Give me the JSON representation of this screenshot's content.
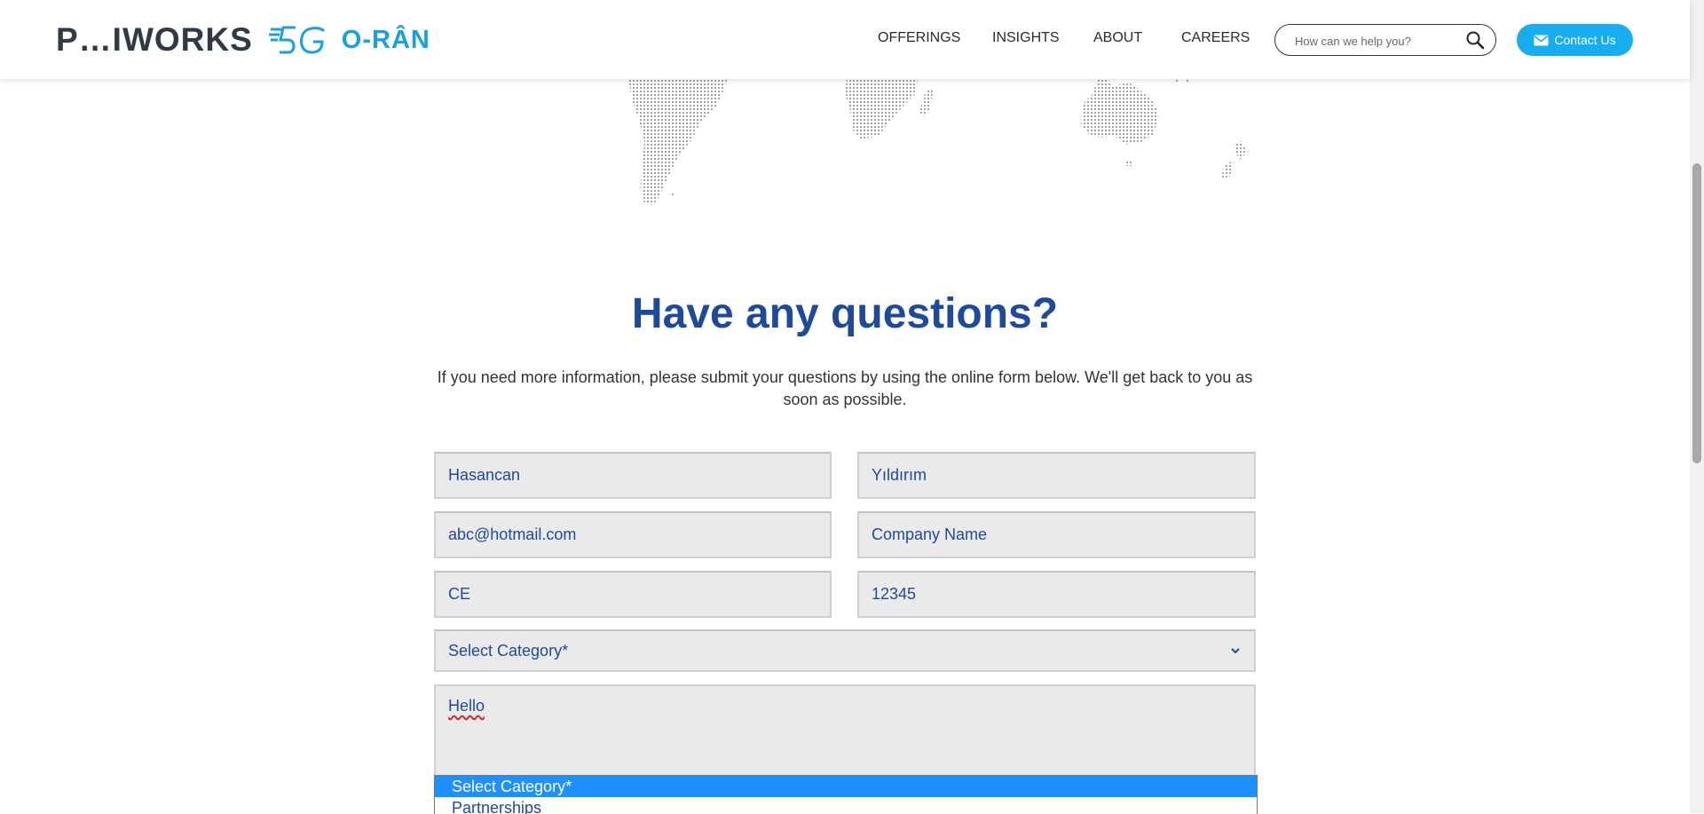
{
  "header": {
    "logo_text": "P…IWORKS",
    "logo_oran": "O-RÂN",
    "nav": [
      "OFFERINGS",
      "INSIGHTS",
      "ABOUT",
      "CAREERS"
    ],
    "search_placeholder": "How can we help you?",
    "contact_label": "Contact Us",
    "accent_color": "#16aef0"
  },
  "main": {
    "heading": "Have any questions?",
    "intro": "If you need more information, please submit your questions by using the online form below. We'll get back to you as soon as possible."
  },
  "form": {
    "first_name": "Hasancan",
    "last_name": "Yıldırım",
    "email": "abc@hotmail.com",
    "company": "Company Name",
    "title": "CE",
    "phone": "12345",
    "category_selected": "Select Category*",
    "message": "Hello",
    "category_options": [
      "Select Category*",
      "Partnerships"
    ]
  },
  "colors": {
    "heading": "#1d4a9b",
    "field_bg": "#eaeaea",
    "option_highlight": "#1e90ff"
  }
}
